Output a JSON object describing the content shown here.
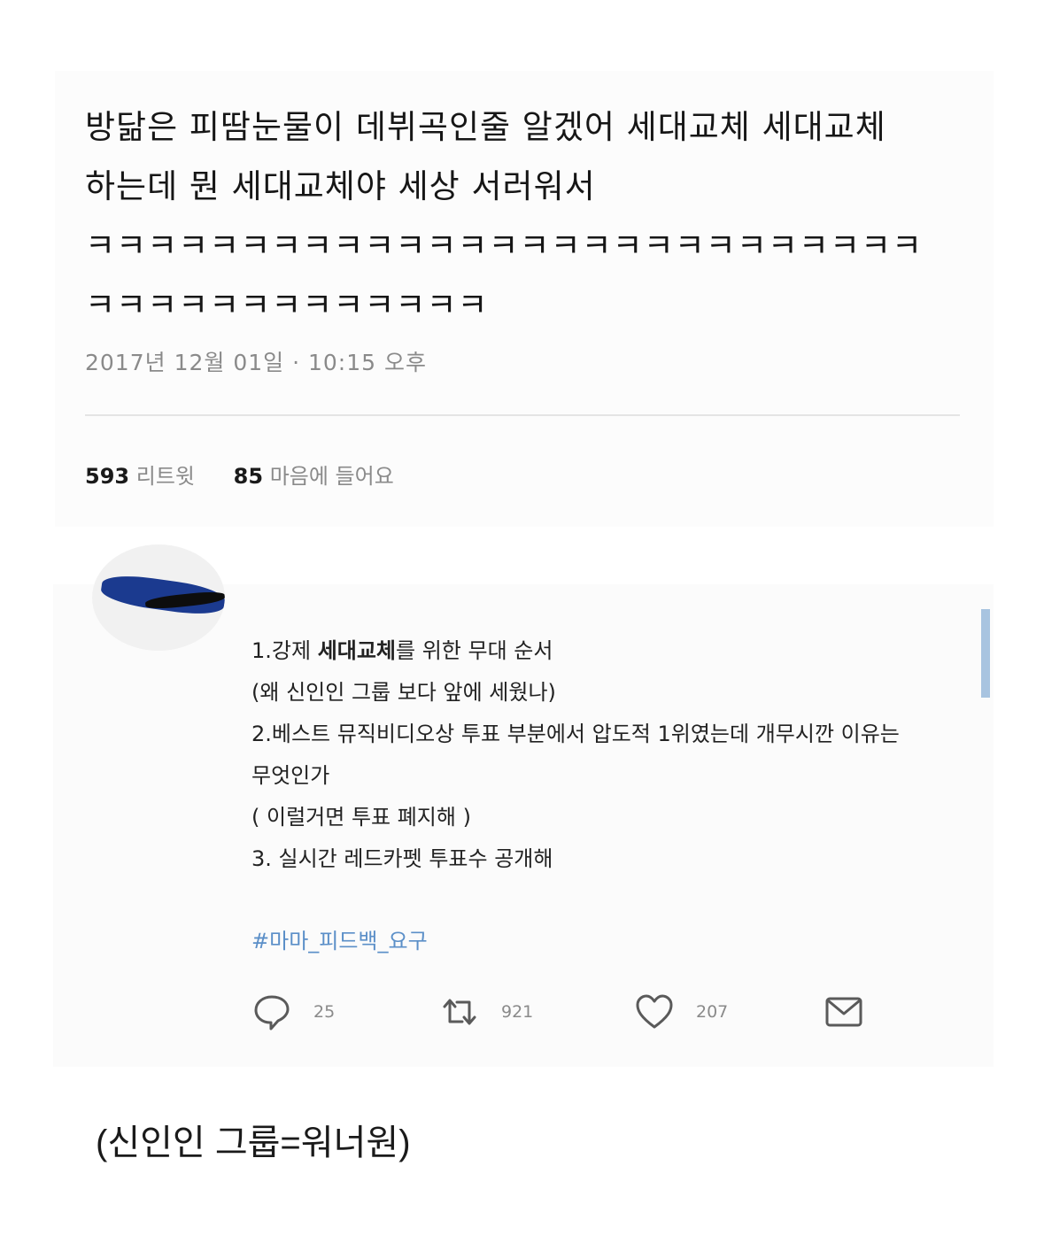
{
  "tweet1": {
    "text": "방닮은 피땀눈물이 데뷔곡인줄 알겠어 세대교체 세대교체\n하는데 뭔 세대교체야 세상 서러워서\nㅋㅋㅋㅋㅋㅋㅋㅋㅋㅋㅋㅋㅋㅋㅋㅋㅋㅋㅋㅋㅋㅋㅋㅋㅋㅋㅋ\nㅋㅋㅋㅋㅋㅋㅋㅋㅋㅋㅋㅋㅋ",
    "date": "2017년 12월 01일 · 10:15 오후",
    "retweets_count": "593",
    "retweets_label": "리트윗",
    "likes_count": "85",
    "likes_label": "마음에 들어요"
  },
  "tweet2": {
    "line1_prefix": "1.강제 ",
    "line1_bold": "세대교체",
    "line1_suffix": "를 위한 무대 순서",
    "line2": "(왜 신인인 그룹 보다 앞에 세웠나)",
    "line3": "2.베스트 뮤직비디오상 투표 부분에서 압도적 1위였는데 개무시깐 이유는",
    "line4": "무엇인가",
    "line5": "( 이럴거면 투표 폐지해 )",
    "line6": "3. 실시간 레드카펫 투표수 공개해",
    "hashtag": "#마마_피드백_요구",
    "reply_count": "25",
    "retweet_count": "921",
    "like_count": "207",
    "icons": [
      "reply-icon",
      "retweet-icon",
      "heart-icon",
      "mail-icon"
    ]
  },
  "caption": "(신인인 그룹=워너원)",
  "colors": {
    "hashtag": "#5b8fc8",
    "muted": "#8a8a8a",
    "scrollbar": "#a8c4e0"
  }
}
